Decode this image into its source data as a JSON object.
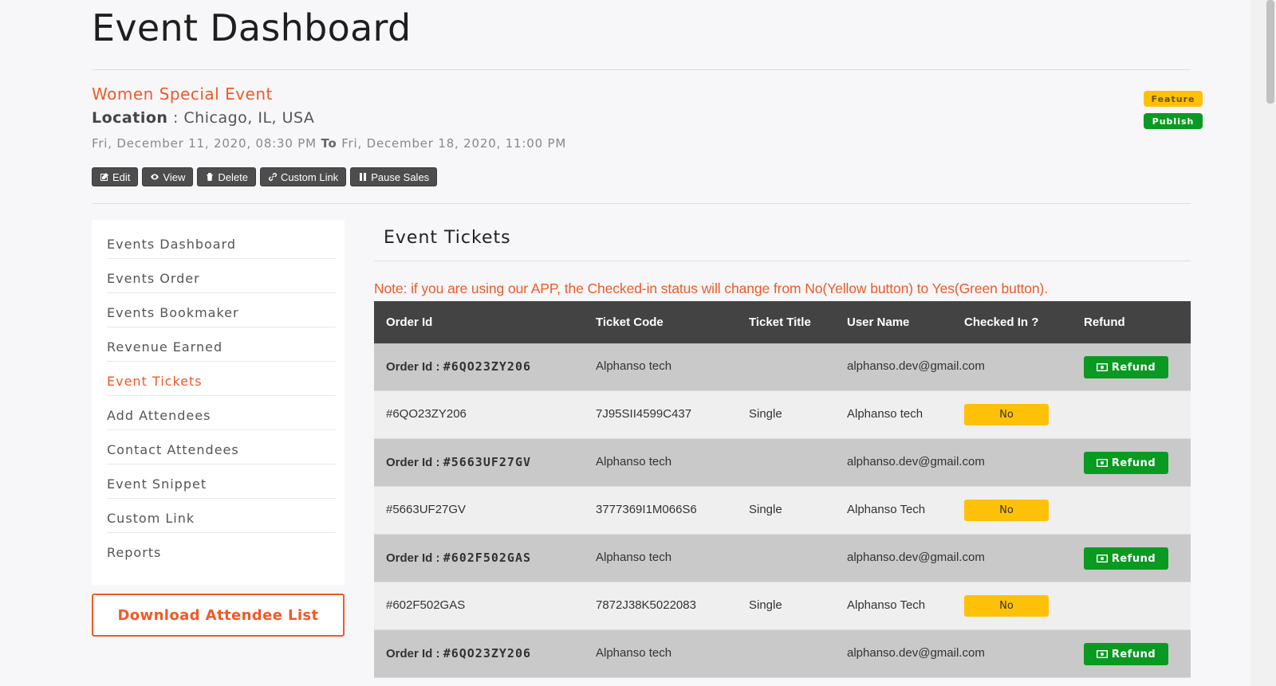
{
  "page": {
    "title": "Event Dashboard"
  },
  "event": {
    "name": "Women Special Event",
    "location_label": "Location",
    "location_sep": " : ",
    "location": "Chicago, IL, USA",
    "start": "Fri, December 11, 2020, 08:30 PM",
    "to_label": "To",
    "end": "Fri, December 18, 2020, 11:00 PM"
  },
  "badges": {
    "feature": "Feature",
    "publish": "Publish"
  },
  "actions": [
    {
      "label": "Edit",
      "icon": "edit-icon"
    },
    {
      "label": "View",
      "icon": "eye-icon"
    },
    {
      "label": "Delete",
      "icon": "trash-icon"
    },
    {
      "label": "Custom Link",
      "icon": "link-icon"
    },
    {
      "label": "Pause Sales",
      "icon": "pause-icon"
    }
  ],
  "sidebar": {
    "items": [
      {
        "label": "Events Dashboard",
        "active": false
      },
      {
        "label": "Events Order",
        "active": false
      },
      {
        "label": "Events Bookmaker",
        "active": false
      },
      {
        "label": "Revenue Earned",
        "active": false
      },
      {
        "label": "Event Tickets",
        "active": true
      },
      {
        "label": "Add Attendees",
        "active": false
      },
      {
        "label": "Contact Attendees",
        "active": false
      },
      {
        "label": "Event Snippet",
        "active": false
      },
      {
        "label": "Custom Link",
        "active": false
      },
      {
        "label": "Reports",
        "active": false
      }
    ],
    "download_label": "Download Attendee List"
  },
  "main": {
    "title": "Event Tickets",
    "note": "Note: if you are using our APP, the Checked-in status will change from No(Yellow button) to Yes(Green button)."
  },
  "table": {
    "headers": [
      "Order Id",
      "Ticket Code",
      "Ticket Title",
      "User Name",
      "Checked In ?",
      "Refund"
    ],
    "order_prefix": "Order Id : ",
    "refund_label": "Refund",
    "no_label": "No",
    "orders": [
      {
        "order_id": "#6QO23ZY206",
        "name": "Alphanso tech",
        "email": "alphanso.dev@gmail.com",
        "ticket": {
          "id": "#6QO23ZY206",
          "code": "7J95SII4599C437",
          "title": "Single",
          "user": "Alphanso tech",
          "checked_in": "No"
        }
      },
      {
        "order_id": "#5663UF27GV",
        "name": "Alphanso tech",
        "email": "alphanso.dev@gmail.com",
        "ticket": {
          "id": "#5663UF27GV",
          "code": "3777369I1M066S6",
          "title": "Single",
          "user": "Alphanso Tech",
          "checked_in": "No"
        }
      },
      {
        "order_id": "#602F502GAS",
        "name": "Alphanso tech",
        "email": "alphanso.dev@gmail.com",
        "ticket": {
          "id": "#602F502GAS",
          "code": "7872J38K5022083",
          "title": "Single",
          "user": "Alphanso Tech",
          "checked_in": "No"
        }
      },
      {
        "order_id": "#6QO23ZY206",
        "name": "Alphanso tech",
        "email": "alphanso.dev@gmail.com"
      }
    ]
  },
  "colors": {
    "accent": "#f05a28",
    "feature": "#ffc107",
    "publish": "#0a9a22",
    "header": "#434343"
  }
}
